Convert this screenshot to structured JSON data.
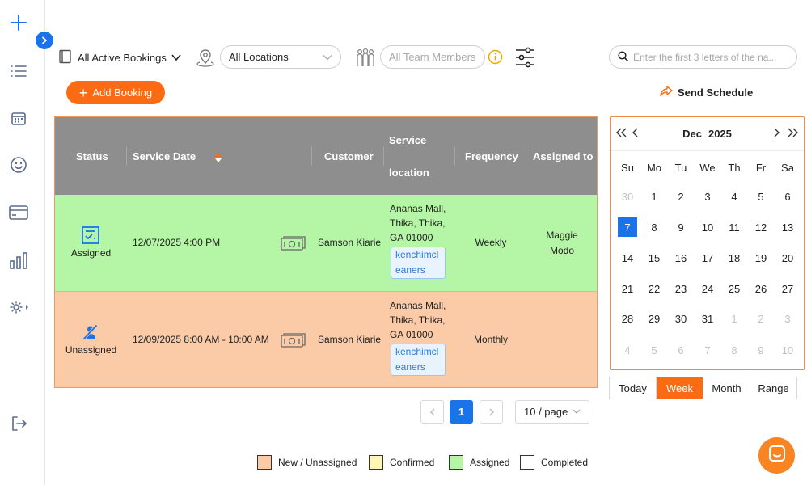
{
  "toolbar": {
    "bookings_filter": "All Active Bookings",
    "location_select": "All Locations",
    "team_placeholder": "All Team Members",
    "search_placeholder": "Enter the first 3 letters of the na..."
  },
  "actions": {
    "add_booking": "Add Booking",
    "send_schedule": "Send Schedule"
  },
  "table": {
    "headers": {
      "status": "Status",
      "service_date": "Service Date",
      "customer": "Customer",
      "service_location_top": "Service",
      "service_location_bottom": "location",
      "frequency": "Frequency",
      "assigned_to": "Assigned to"
    },
    "rows": [
      {
        "status": "Assigned",
        "date": "12/07/2025 4:00 PM",
        "customer": "Samson Kiarie",
        "loc1": "Ananas Mall,",
        "loc2": "Thika, Thika,",
        "loc3": "GA 01000",
        "tag": "kenchimcleaners",
        "frequency": "Weekly",
        "assigned1": "Maggie",
        "assigned2": "Modo"
      },
      {
        "status": "Unassigned",
        "date": "12/09/2025 8:00 AM - 10:00 AM",
        "customer": "Samson Kiarie",
        "loc1": "Ananas Mall,",
        "loc2": "Thika, Thika,",
        "loc3": "GA 01000",
        "tag": "kenchimcleaners",
        "frequency": "Monthly",
        "assigned1": "",
        "assigned2": ""
      }
    ]
  },
  "pagination": {
    "current_page": "1",
    "page_size": "10 / page"
  },
  "legend": [
    {
      "label": "New / Unassigned",
      "color": "#fbcba8"
    },
    {
      "label": "Confirmed",
      "color": "#fff6b3"
    },
    {
      "label": "Assigned",
      "color": "#b4f5a6"
    },
    {
      "label": "Completed",
      "color": "#ffffff"
    }
  ],
  "calendar": {
    "month": "Dec",
    "year": "2025",
    "weekdays": [
      "Su",
      "Mo",
      "Tu",
      "We",
      "Th",
      "Fr",
      "Sa"
    ],
    "weeks": [
      [
        "30",
        "1",
        "2",
        "3",
        "4",
        "5",
        "6"
      ],
      [
        "7",
        "8",
        "9",
        "10",
        "11",
        "12",
        "13"
      ],
      [
        "14",
        "15",
        "16",
        "17",
        "18",
        "19",
        "20"
      ],
      [
        "21",
        "22",
        "23",
        "24",
        "25",
        "26",
        "27"
      ],
      [
        "28",
        "29",
        "30",
        "31",
        "1",
        "2",
        "3"
      ],
      [
        "4",
        "5",
        "6",
        "7",
        "8",
        "9",
        "10"
      ]
    ],
    "selected": "7",
    "range_tabs": [
      "Today",
      "Week",
      "Month",
      "Range"
    ],
    "active_tab": "Week"
  },
  "colors": {
    "accent": "#fa6b14",
    "primary_blue": "#1a73e8",
    "assigned_row": "#b4f5a6",
    "unassigned_row": "#fbcba8",
    "header_gray": "#8e8e8e"
  },
  "icons": {
    "sidebar": [
      "plus-icon",
      "list-icon",
      "calendar-icon",
      "smiley-icon",
      "card-icon",
      "bar-chart-icon",
      "settings-icon",
      "logout-icon"
    ]
  }
}
